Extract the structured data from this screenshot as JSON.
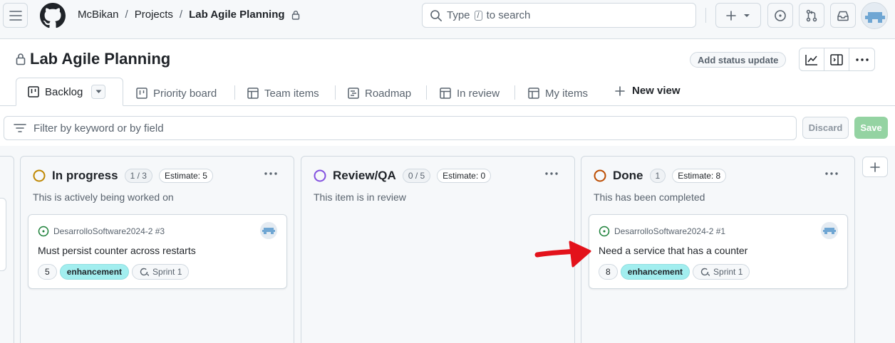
{
  "header": {
    "breadcrumb": {
      "owner": "McBikan",
      "section": "Projects",
      "project": "Lab Agile Planning",
      "separator": "/"
    },
    "search": {
      "prefix": "Type",
      "key": "/",
      "suffix": "to search"
    }
  },
  "project": {
    "title": "Lab Agile Planning",
    "status_button": "Add status update"
  },
  "views": {
    "tabs": [
      {
        "label": "Backlog"
      },
      {
        "label": "Priority board"
      },
      {
        "label": "Team items"
      },
      {
        "label": "Roadmap"
      },
      {
        "label": "In review"
      },
      {
        "label": "My items"
      }
    ],
    "new_view": "New view"
  },
  "filter": {
    "placeholder": "Filter by keyword or by field",
    "discard": "Discard",
    "save": "Save"
  },
  "columns": [
    {
      "title": "In progress",
      "count": "1 / 3",
      "estimate": "Estimate: 5",
      "description": "This is actively being worked on",
      "status_color": "#bf8700",
      "cards": [
        {
          "repo": "DesarrolloSoftware2024-2 #3",
          "title": "Must persist counter across restarts",
          "estimate": "5",
          "label": "enhancement",
          "sprint": "Sprint 1"
        }
      ]
    },
    {
      "title": "Review/QA",
      "count": "0 / 5",
      "estimate": "Estimate: 0",
      "description": "This item is in review",
      "status_color": "#8250df",
      "cards": []
    },
    {
      "title": "Done",
      "count": "1",
      "estimate": "Estimate: 8",
      "description": "This has been completed",
      "status_color": "#bc4c00",
      "cards": [
        {
          "repo": "DesarrolloSoftware2024-2 #1",
          "title": "Need a service that has a counter",
          "estimate": "8",
          "label": "enhancement",
          "sprint": "Sprint 1"
        }
      ]
    }
  ],
  "colors": {
    "open_issue": "#1a7f37",
    "enhancement_label": "#a2eeef",
    "save_button": "#94d3a2",
    "annotation_arrow": "#e3121b"
  }
}
